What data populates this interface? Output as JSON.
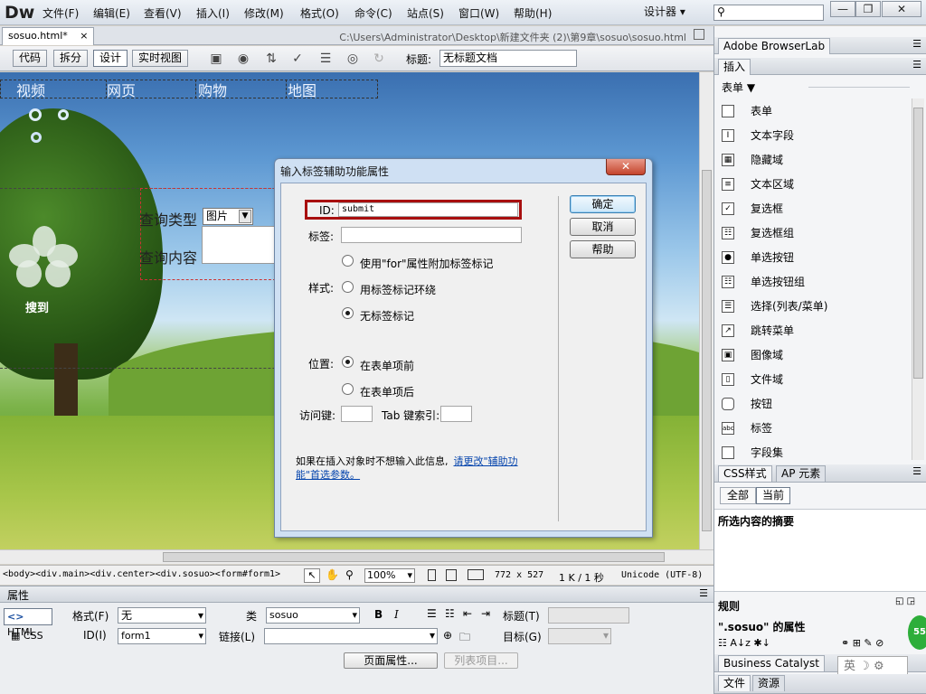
{
  "app": {
    "logo": "Dw",
    "menus": [
      "文件(F)",
      "编辑(E)",
      "查看(V)",
      "插入(I)",
      "修改(M)",
      "格式(O)",
      "命令(C)",
      "站点(S)",
      "窗口(W)",
      "帮助(H)"
    ],
    "workspace": "设计器",
    "window_buttons": {
      "minimize": "—",
      "restore": "❐",
      "close": "✕"
    }
  },
  "document": {
    "tab_label": "sosuo.html*",
    "tab_close": "×",
    "path": "C:\\Users\\Administrator\\Desktop\\新建文件夹 (2)\\第9章\\sosuo\\sosuo.html"
  },
  "toolbar": {
    "view_buttons": [
      "代码",
      "拆分",
      "设计",
      "实时视图"
    ],
    "title_label": "标题:",
    "title_value": "无标题文档"
  },
  "canvas": {
    "nav": [
      "视频",
      "网页",
      "购物",
      "地图"
    ],
    "logo_text": "搜到",
    "query_type_label": "查询类型",
    "query_type_value": "图片",
    "query_content_label": "查询内容"
  },
  "dialog": {
    "title": "输入标签辅助功能属性",
    "close": "✕",
    "id_label": "ID:",
    "id_value": "submit",
    "label_label": "标签:",
    "style_label": "样式:",
    "style_options": [
      "使用\"for\"属性附加标签标记",
      "用标签标记环绕",
      "无标签标记"
    ],
    "style_selected": 2,
    "position_label": "位置:",
    "position_options": [
      "在表单项前",
      "在表单项后"
    ],
    "position_selected": 0,
    "access_key_label": "访问键:",
    "tab_index_label": "Tab 键索引:",
    "note_text": "如果在插入对象时不想输入此信息,",
    "note_link": "请更改\"辅助功能\"首选参数。",
    "buttons": {
      "ok": "确定",
      "cancel": "取消",
      "help": "帮助"
    }
  },
  "statusbar": {
    "tags": "<body><div.main><div.center><div.sosuo><form#form1>",
    "zoom": "100%",
    "size": "772 x 527",
    "file_info": "1 K / 1 秒",
    "encoding": "Unicode (UTF-8)"
  },
  "properties": {
    "title": "属性",
    "html_tab": "HTML",
    "css_tab": "CSS",
    "format_label": "格式(F)",
    "format_value": "无",
    "class_label": "类",
    "class_value": "sosuo",
    "id_label": "ID(I)",
    "id_value": "form1",
    "link_label": "链接(L)",
    "title_label": "标题(T)",
    "target_label": "目标(G)",
    "bold": "B",
    "italic": "I",
    "page_props_button": "页面属性...",
    "list_items_button": "列表项目..."
  },
  "right_panel": {
    "browserlab": "Adobe BrowserLab",
    "insert_tab": "插入",
    "category": "表单",
    "items": [
      {
        "icon": "form-icon",
        "label": "表单"
      },
      {
        "icon": "text-field-icon",
        "label": "文本字段"
      },
      {
        "icon": "hidden-field-icon",
        "label": "隐藏域"
      },
      {
        "icon": "textarea-icon",
        "label": "文本区域"
      },
      {
        "icon": "checkbox-icon",
        "label": "复选框"
      },
      {
        "icon": "checkbox-group-icon",
        "label": "复选框组"
      },
      {
        "icon": "radio-icon",
        "label": "单选按钮"
      },
      {
        "icon": "radio-group-icon",
        "label": "单选按钮组"
      },
      {
        "icon": "select-icon",
        "label": "选择(列表/菜单)"
      },
      {
        "icon": "jump-menu-icon",
        "label": "跳转菜单"
      },
      {
        "icon": "image-field-icon",
        "label": "图像域"
      },
      {
        "icon": "file-field-icon",
        "label": "文件域"
      },
      {
        "icon": "button-icon",
        "label": "按钮"
      },
      {
        "icon": "label-icon",
        "label": "标签"
      },
      {
        "icon": "fieldset-icon",
        "label": "字段集"
      }
    ],
    "css_tab": "CSS样式",
    "ap_tab": "AP 元素",
    "all_btn": "全部",
    "current_btn": "当前",
    "summary": "所选内容的摘要",
    "rules": "规则",
    "properties_of": "\".sosuo\" 的属性",
    "business_catalyst": "Business Catalyst",
    "files_tab": "文件",
    "assets_tab": "资源",
    "ime": "英"
  }
}
